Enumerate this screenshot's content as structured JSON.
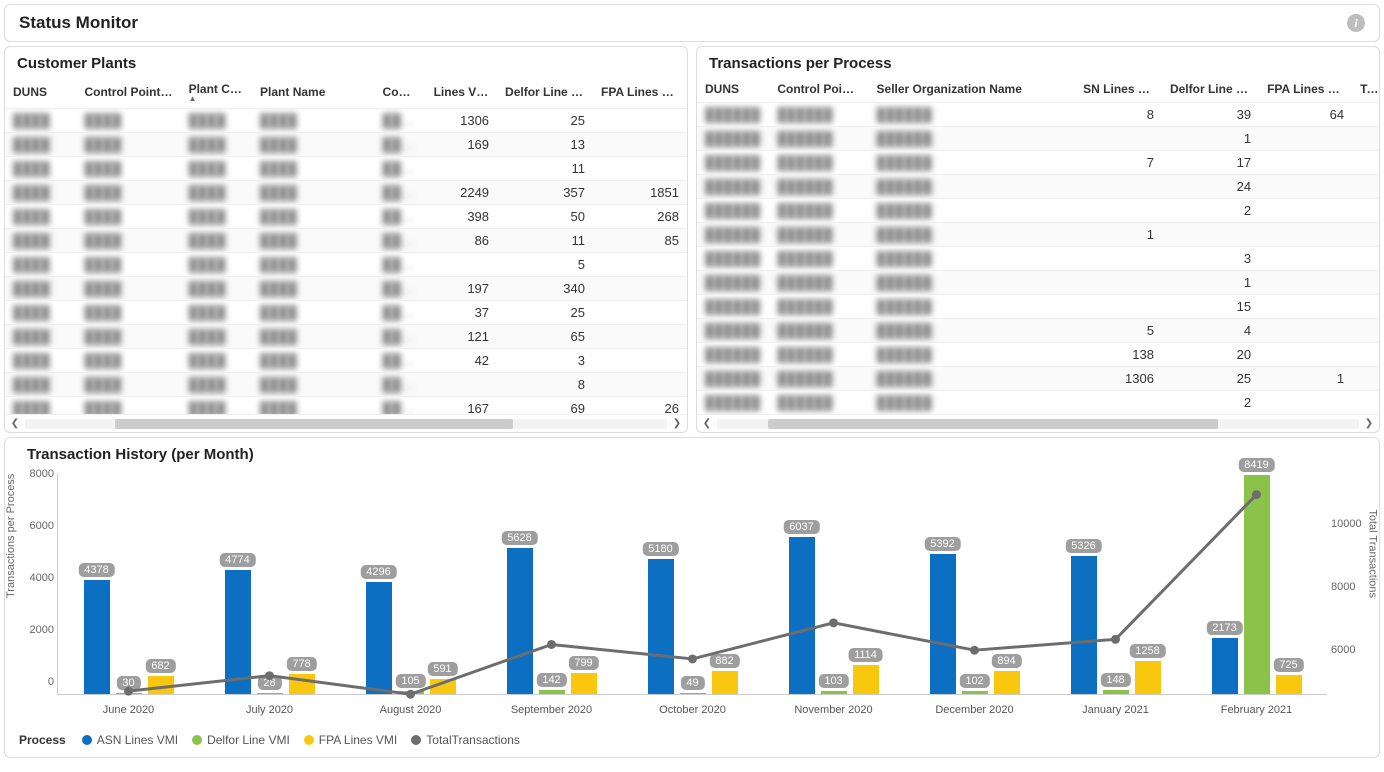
{
  "header": {
    "title": "Status Monitor"
  },
  "customer_plants": {
    "title": "Customer Plants",
    "columns": [
      "DUNS",
      "Control Point ID",
      "Plant Code",
      "Plant Name",
      "Country",
      "Lines VMI",
      "Delfor Line VMI",
      "FPA Lines VMI"
    ],
    "sort_column": "Plant Code",
    "rows": [
      {
        "lines_vmi": 1306,
        "delfor": 25,
        "fpa": null
      },
      {
        "lines_vmi": 169,
        "delfor": 13,
        "fpa": null
      },
      {
        "lines_vmi": null,
        "delfor": 11,
        "fpa": null
      },
      {
        "lines_vmi": 2249,
        "delfor": 357,
        "fpa": 1851
      },
      {
        "lines_vmi": 398,
        "delfor": 50,
        "fpa": 268
      },
      {
        "lines_vmi": 86,
        "delfor": 11,
        "fpa": 85
      },
      {
        "lines_vmi": null,
        "delfor": 5,
        "fpa": null
      },
      {
        "lines_vmi": 197,
        "delfor": 340,
        "fpa": null
      },
      {
        "lines_vmi": 37,
        "delfor": 25,
        "fpa": null
      },
      {
        "lines_vmi": 121,
        "delfor": 65,
        "fpa": null
      },
      {
        "lines_vmi": 42,
        "delfor": 3,
        "fpa": null
      },
      {
        "lines_vmi": null,
        "delfor": 8,
        "fpa": null
      },
      {
        "lines_vmi": 167,
        "delfor": 69,
        "fpa": 26
      }
    ]
  },
  "transactions_per_process": {
    "title": "Transactions per Process",
    "columns": [
      "DUNS",
      "Control Point ID",
      "Seller Organization Name",
      "SN Lines VMI",
      "Delfor Line VMI",
      "FPA Lines VMI",
      "To"
    ],
    "rows": [
      {
        "sn": 8,
        "delfor": 39,
        "fpa": 64
      },
      {
        "sn": null,
        "delfor": 1,
        "fpa": null
      },
      {
        "sn": 7,
        "delfor": 17,
        "fpa": null
      },
      {
        "sn": null,
        "delfor": 24,
        "fpa": null
      },
      {
        "sn": null,
        "delfor": 2,
        "fpa": null
      },
      {
        "sn": 1,
        "delfor": null,
        "fpa": null
      },
      {
        "sn": null,
        "delfor": 3,
        "fpa": null
      },
      {
        "sn": null,
        "delfor": 1,
        "fpa": null
      },
      {
        "sn": null,
        "delfor": 15,
        "fpa": null
      },
      {
        "sn": 5,
        "delfor": 4,
        "fpa": null
      },
      {
        "sn": 138,
        "delfor": 20,
        "fpa": null
      },
      {
        "sn": 1306,
        "delfor": 25,
        "fpa": "1"
      },
      {
        "sn": null,
        "delfor": 2,
        "fpa": null
      }
    ]
  },
  "transaction_history": {
    "title": "Transaction History (per Month)",
    "ylabel_left": "Transactions per Process",
    "ylabel_right": "Total Transactions",
    "legend_title": "Process",
    "legend": [
      "ASN Lines VMI",
      "Delfor Line VMI",
      "FPA Lines VMI",
      "TotalTransactions"
    ]
  },
  "chart_data": {
    "type": "bar",
    "title": "Transaction History (per Month)",
    "categories": [
      "June 2020",
      "July 2020",
      "August 2020",
      "September 2020",
      "October 2020",
      "November 2020",
      "December 2020",
      "January 2021",
      "February 2021"
    ],
    "series": [
      {
        "name": "ASN Lines VMI",
        "axis": "left",
        "color": "#0c6fc2",
        "values": [
          4378,
          4774,
          4296,
          5628,
          5180,
          6037,
          5392,
          5326,
          2173
        ]
      },
      {
        "name": "Delfor Line VMI",
        "axis": "left",
        "color": "#8bc34a",
        "values": [
          30,
          28,
          105,
          142,
          49,
          103,
          102,
          148,
          8419
        ]
      },
      {
        "name": "FPA Lines VMI",
        "axis": "left",
        "color": "#f9c80e",
        "values": [
          682,
          778,
          591,
          799,
          882,
          1114,
          894,
          1258,
          725
        ]
      },
      {
        "name": "TotalTransactions",
        "axis": "right",
        "type": "line",
        "color": "#6d6d6d",
        "values": [
          5090,
          5580,
          4992,
          6569,
          6111,
          7254,
          6388,
          6732,
          11317
        ]
      }
    ],
    "ylabel_left": "Transactions per Process",
    "ylabel_right": "Total Transactions",
    "ylim_left": [
      0,
      8500
    ],
    "ylim_right": [
      5000,
      12000
    ],
    "yticks_left": [
      0,
      2000,
      4000,
      6000,
      8000
    ],
    "yticks_right": [
      6000,
      8000,
      10000
    ],
    "legend_position": "bottom"
  },
  "colors": {
    "asn": "#0c6fc2",
    "delfor": "#8bc34a",
    "fpa": "#f9c80e",
    "total": "#6d6d6d"
  }
}
